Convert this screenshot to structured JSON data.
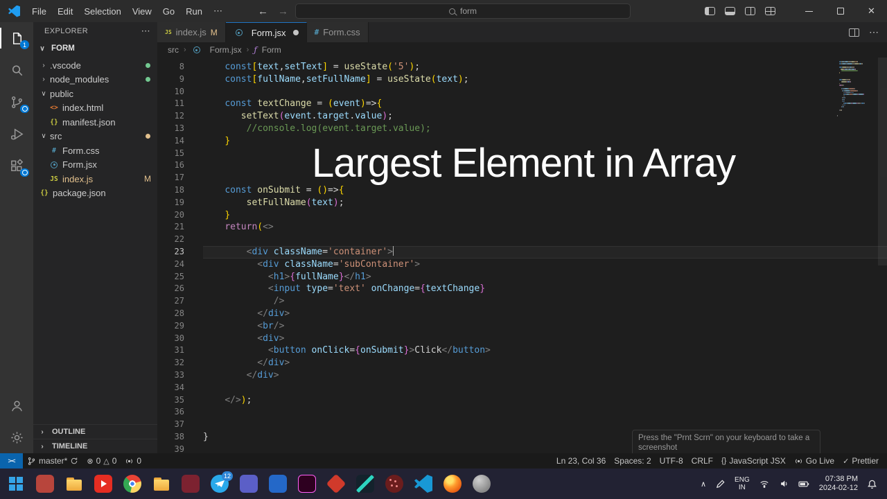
{
  "colors": {
    "accent_blue": "#0078d4",
    "git_modified": "#e2c08d",
    "git_clean_dot": "#73c991",
    "overlay_text": "#ffffff",
    "remote_bg": "#0a64ad"
  },
  "titlebar": {
    "menus": [
      "File",
      "Edit",
      "Selection",
      "View",
      "Go",
      "Run"
    ],
    "menu_more": "⋯",
    "search_text": "form",
    "window_icons": [
      "toggle-sidebar",
      "toggle-panel",
      "toggle-secondary-sidebar",
      "customize-layout",
      "minimize",
      "maximize",
      "close"
    ]
  },
  "activity_bar": {
    "top": [
      {
        "id": "explorer",
        "badge": "1",
        "active": true
      },
      {
        "id": "search"
      },
      {
        "id": "source-control",
        "pending": true
      },
      {
        "id": "run-debug"
      },
      {
        "id": "extensions",
        "pending": true
      }
    ],
    "bottom": [
      {
        "id": "account"
      },
      {
        "id": "settings"
      }
    ]
  },
  "sidebar": {
    "title": "EXPLORER",
    "more": "⋯",
    "section": "FORM",
    "tree": [
      {
        "label": ".vscode",
        "kind": "folder",
        "chev": "›",
        "ind": 0,
        "dot": "#73c991"
      },
      {
        "label": "node_modules",
        "kind": "folder",
        "chev": "›",
        "ind": 0,
        "dot": "#73c991"
      },
      {
        "label": "public",
        "kind": "folder",
        "chev": "∨",
        "ind": 0
      },
      {
        "label": "index.html",
        "kind": "html",
        "ind": 1
      },
      {
        "label": "manifest.json",
        "kind": "json",
        "ind": 1
      },
      {
        "label": "src",
        "kind": "folder",
        "chev": "∨",
        "ind": 0,
        "dot": "#e2c08d"
      },
      {
        "label": "Form.css",
        "kind": "css",
        "ind": 1
      },
      {
        "label": "Form.jsx",
        "kind": "react",
        "ind": 1
      },
      {
        "label": "index.js",
        "kind": "js",
        "ind": 1,
        "badge": "M",
        "modified": true
      },
      {
        "label": "package.json",
        "kind": "json",
        "ind": 0
      }
    ],
    "panels": [
      "OUTLINE",
      "TIMELINE"
    ]
  },
  "tabs": [
    {
      "label": "index.js",
      "kind": "js",
      "badge": "M"
    },
    {
      "label": "Form.jsx",
      "kind": "react",
      "dirty": true,
      "active": true
    },
    {
      "label": "Form.css",
      "kind": "css"
    }
  ],
  "breadcrumbs": [
    {
      "label": "src"
    },
    {
      "label": "Form.jsx",
      "kind": "react"
    },
    {
      "label": "Form",
      "kind": "symbol-function"
    }
  ],
  "editor": {
    "active_line": 23,
    "lines": [
      {
        "n": 8,
        "ind": 4,
        "t": [
          [
            "kw",
            "const"
          ],
          [
            "b1",
            "["
          ],
          [
            "v",
            "text"
          ],
          [
            "p",
            ","
          ],
          [
            "v",
            "setText"
          ],
          [
            "b1",
            "]"
          ],
          [
            "p",
            " = "
          ],
          [
            "f",
            "useState"
          ],
          [
            "b1",
            "("
          ],
          [
            "s",
            "'5'"
          ],
          [
            "b1",
            ")"
          ],
          [
            "p",
            ";"
          ]
        ]
      },
      {
        "n": 9,
        "ind": 4,
        "t": [
          [
            "kw",
            "const"
          ],
          [
            "b1",
            "["
          ],
          [
            "v",
            "fullName"
          ],
          [
            "p",
            ","
          ],
          [
            "v",
            "setFullName"
          ],
          [
            "b1",
            "]"
          ],
          [
            "p",
            " = "
          ],
          [
            "f",
            "useState"
          ],
          [
            "b1",
            "("
          ],
          [
            "v",
            "text"
          ],
          [
            "b1",
            ")"
          ],
          [
            "p",
            ";"
          ]
        ]
      },
      {
        "n": 10,
        "ind": 0,
        "t": []
      },
      {
        "n": 11,
        "ind": 4,
        "t": [
          [
            "kw",
            "const "
          ],
          [
            "f",
            "textChange"
          ],
          [
            "p",
            " = "
          ],
          [
            "b1",
            "("
          ],
          [
            "v",
            "event"
          ],
          [
            "b1",
            ")"
          ],
          [
            "p",
            "=>"
          ],
          [
            "b1",
            "{"
          ]
        ]
      },
      {
        "n": 12,
        "ind": 7,
        "t": [
          [
            "f",
            "setText"
          ],
          [
            "b2",
            "("
          ],
          [
            "v",
            "event"
          ],
          [
            "p",
            "."
          ],
          [
            "v",
            "target"
          ],
          [
            "p",
            "."
          ],
          [
            "v",
            "value"
          ],
          [
            "b2",
            ")"
          ],
          [
            "p",
            ";"
          ]
        ]
      },
      {
        "n": 13,
        "ind": 8,
        "t": [
          [
            "c",
            "//console.log(event.target.value);"
          ]
        ]
      },
      {
        "n": 14,
        "ind": 4,
        "t": [
          [
            "b1",
            "}"
          ]
        ]
      },
      {
        "n": 15,
        "ind": 0,
        "t": []
      },
      {
        "n": 16,
        "ind": 0,
        "t": []
      },
      {
        "n": 17,
        "ind": 0,
        "t": []
      },
      {
        "n": 18,
        "ind": 4,
        "t": [
          [
            "kw",
            "const "
          ],
          [
            "f",
            "onSubmit"
          ],
          [
            "p",
            " = "
          ],
          [
            "b1",
            "()"
          ],
          [
            "p",
            "=>"
          ],
          [
            "b1",
            "{"
          ]
        ]
      },
      {
        "n": 19,
        "ind": 8,
        "t": [
          [
            "f",
            "setFullName"
          ],
          [
            "b2",
            "("
          ],
          [
            "v",
            "text"
          ],
          [
            "b2",
            ")"
          ],
          [
            "p",
            ";"
          ]
        ]
      },
      {
        "n": 20,
        "ind": 4,
        "t": [
          [
            "b1",
            "}"
          ]
        ]
      },
      {
        "n": 21,
        "ind": 4,
        "t": [
          [
            "k2",
            "return"
          ],
          [
            "b1",
            "("
          ],
          [
            "g",
            "<>"
          ]
        ]
      },
      {
        "n": 22,
        "ind": 0,
        "t": []
      },
      {
        "n": 23,
        "ind": 8,
        "t": [
          [
            "g",
            "<"
          ],
          [
            "t",
            "div"
          ],
          [
            "p",
            " "
          ],
          [
            "a",
            "className"
          ],
          [
            "p",
            "="
          ],
          [
            "s",
            "'container'"
          ],
          [
            "g",
            ">"
          ]
        ]
      },
      {
        "n": 24,
        "ind": 10,
        "t": [
          [
            "g",
            "<"
          ],
          [
            "t",
            "div"
          ],
          [
            "p",
            " "
          ],
          [
            "a",
            "className"
          ],
          [
            "p",
            "="
          ],
          [
            "s",
            "'subContainer'"
          ],
          [
            "g",
            ">"
          ]
        ]
      },
      {
        "n": 25,
        "ind": 12,
        "t": [
          [
            "g",
            "<"
          ],
          [
            "t",
            "h1"
          ],
          [
            "g",
            ">"
          ],
          [
            "b2",
            "{"
          ],
          [
            "v",
            "fullName"
          ],
          [
            "b2",
            "}"
          ],
          [
            "g",
            "</"
          ],
          [
            "t",
            "h1"
          ],
          [
            "g",
            ">"
          ]
        ]
      },
      {
        "n": 26,
        "ind": 12,
        "t": [
          [
            "g",
            "<"
          ],
          [
            "t",
            "input"
          ],
          [
            "p",
            " "
          ],
          [
            "a",
            "type"
          ],
          [
            "p",
            "="
          ],
          [
            "s",
            "'text'"
          ],
          [
            "p",
            " "
          ],
          [
            "a",
            "onChange"
          ],
          [
            "p",
            "="
          ],
          [
            "b2",
            "{"
          ],
          [
            "v",
            "textChange"
          ],
          [
            "b2",
            "}"
          ]
        ]
      },
      {
        "n": 27,
        "ind": 13,
        "t": [
          [
            "g",
            "/>"
          ]
        ]
      },
      {
        "n": 28,
        "ind": 10,
        "t": [
          [
            "g",
            "</"
          ],
          [
            "t",
            "div"
          ],
          [
            "g",
            ">"
          ]
        ]
      },
      {
        "n": 29,
        "ind": 10,
        "t": [
          [
            "g",
            "<"
          ],
          [
            "t",
            "br"
          ],
          [
            "g",
            "/>"
          ]
        ]
      },
      {
        "n": 30,
        "ind": 10,
        "t": [
          [
            "g",
            "<"
          ],
          [
            "t",
            "div"
          ],
          [
            "g",
            ">"
          ]
        ]
      },
      {
        "n": 31,
        "ind": 12,
        "t": [
          [
            "g",
            "<"
          ],
          [
            "t",
            "button"
          ],
          [
            "p",
            " "
          ],
          [
            "a",
            "onClick"
          ],
          [
            "p",
            "="
          ],
          [
            "b2",
            "{"
          ],
          [
            "v",
            "onSubmit"
          ],
          [
            "b2",
            "}"
          ],
          [
            "g",
            ">"
          ],
          [
            "p",
            "Click"
          ],
          [
            "g",
            "</"
          ],
          [
            "t",
            "button"
          ],
          [
            "g",
            ">"
          ]
        ]
      },
      {
        "n": 32,
        "ind": 10,
        "t": [
          [
            "g",
            "</"
          ],
          [
            "t",
            "div"
          ],
          [
            "g",
            ">"
          ]
        ]
      },
      {
        "n": 33,
        "ind": 8,
        "t": [
          [
            "g",
            "</"
          ],
          [
            "t",
            "div"
          ],
          [
            "g",
            ">"
          ]
        ]
      },
      {
        "n": 34,
        "ind": 0,
        "t": []
      },
      {
        "n": 35,
        "ind": 4,
        "t": [
          [
            "g",
            "</>"
          ],
          [
            "b1",
            ")"
          ],
          [
            "p",
            ";"
          ]
        ]
      },
      {
        "n": 36,
        "ind": 0,
        "t": []
      },
      {
        "n": 37,
        "ind": 0,
        "t": []
      },
      {
        "n": 38,
        "ind": 0,
        "t": [
          [
            "p",
            "}"
          ]
        ]
      },
      {
        "n": 39,
        "ind": 0,
        "t": []
      }
    ]
  },
  "overlay_title": "Largest Element in Array",
  "notification": "Press the \"Prnt Scrn\" on your keyboard to take a screenshot",
  "status_bar": {
    "remote_label": "><",
    "branch": "master*",
    "errors": "0",
    "warnings": "0",
    "ports": "0",
    "cursor": "Ln 23, Col 36",
    "indent": "Spaces: 2",
    "encoding": "UTF-8",
    "eol": "CRLF",
    "language": "JavaScript JSX",
    "language_icon": "{}",
    "live_server": "Go Live",
    "formatter": "Prettier",
    "formatter_check": "✓"
  },
  "taskbar": {
    "apps": [
      {
        "id": "start"
      },
      {
        "id": "app-red"
      },
      {
        "id": "file-explorer"
      },
      {
        "id": "youtube"
      },
      {
        "id": "chrome"
      },
      {
        "id": "folder"
      },
      {
        "id": "app-maroon"
      },
      {
        "id": "telegram",
        "badge": "12"
      },
      {
        "id": "app-violet"
      },
      {
        "id": "app-blue"
      },
      {
        "id": "adobe-xd"
      },
      {
        "id": "app-crimson"
      },
      {
        "id": "app-teal"
      },
      {
        "id": "app-dots"
      },
      {
        "id": "vscode"
      },
      {
        "id": "firefox"
      },
      {
        "id": "app-gray"
      }
    ],
    "tray": {
      "icons": [
        "chevron-up",
        "pen",
        "wifi",
        "volume",
        "battery",
        "notifications"
      ],
      "lang_top": "ENG",
      "lang_bottom": "IN",
      "time": "07:38 PM",
      "date": "2024-02-12"
    }
  }
}
